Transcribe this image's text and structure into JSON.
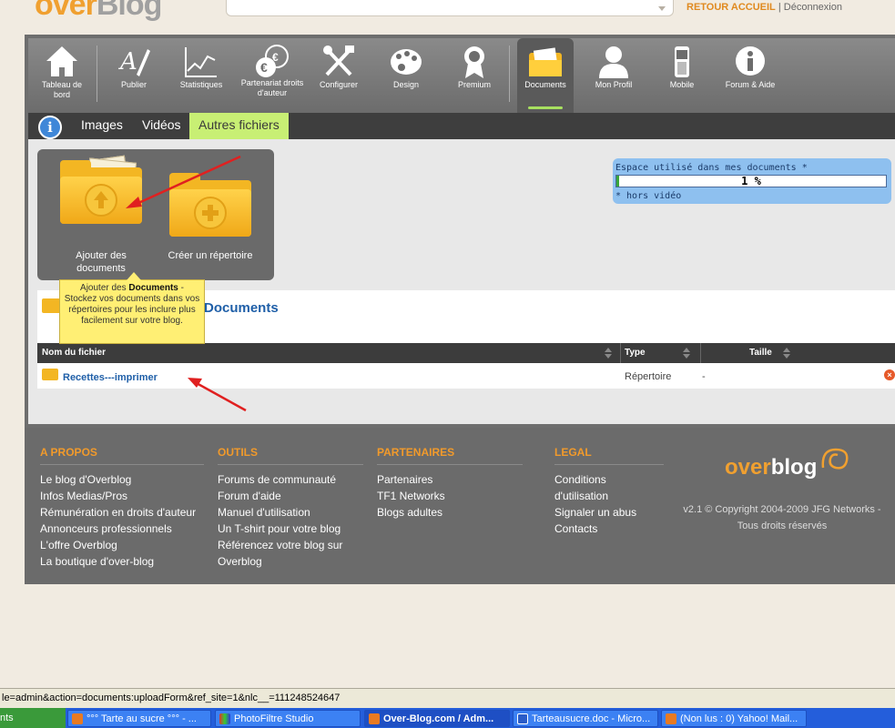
{
  "header": {
    "logo_prefix": "over",
    "logo_suffix": "Blog",
    "home_link": "RETOUR ACCUEIL",
    "separator": " | ",
    "logout_link": "Déconnexion"
  },
  "nav": {
    "items": [
      {
        "label": "Tableau de bord",
        "icon": "house-icon"
      },
      {
        "label": "Publier",
        "icon": "pen-icon"
      },
      {
        "label": "Statistiques",
        "icon": "chart-icon"
      },
      {
        "label": "Partenariat droits d'auteur",
        "icon": "euro-icon"
      },
      {
        "label": "Configurer",
        "icon": "tools-icon"
      },
      {
        "label": "Design",
        "icon": "palette-icon"
      },
      {
        "label": "Premium",
        "icon": "ribbon-icon"
      },
      {
        "label": "Documents",
        "icon": "folder-icon"
      },
      {
        "label": "Mon Profil",
        "icon": "user-icon"
      },
      {
        "label": "Mobile",
        "icon": "phone-icon"
      },
      {
        "label": "Forum & Aide",
        "icon": "info-icon"
      }
    ],
    "active": "Documents"
  },
  "subnav": {
    "tabs": [
      "Images",
      "Vidéos",
      "Autres fichiers"
    ],
    "active": "Autres fichiers"
  },
  "actions": {
    "add": "Ajouter des documents",
    "create": "Créer un répertoire"
  },
  "tooltip": {
    "prefix": "Ajouter des ",
    "bold": "Documents",
    "suffix": " - Stockez vos documents dans vos répertoires pour les inclure plus facilement sur votre blog."
  },
  "quota": {
    "title": "Espace utilisé dans mes documents *",
    "percent_label": "1 %",
    "percent_value": 1,
    "note": "* hors vidéo"
  },
  "documents": {
    "title": "Documents",
    "columns": [
      "Nom du fichier",
      "Type",
      "Taille"
    ],
    "rows": [
      {
        "name": "Recettes---imprimer",
        "type": "Répertoire",
        "size": "-"
      }
    ]
  },
  "footer": {
    "columns": [
      {
        "title": "A PROPOS",
        "links": [
          "Le blog d'Overblog",
          "Infos Medias/Pros",
          "Rémunération en droits d'auteur",
          "Annonceurs professionnels",
          "L'offre Overblog",
          "La boutique d'over-blog"
        ]
      },
      {
        "title": "OUTILS",
        "links": [
          "Forums de communauté",
          "Forum d'aide",
          "Manuel d'utilisation",
          "Un T-shirt pour votre blog",
          "Référencez votre blog sur",
          "Overblog"
        ]
      },
      {
        "title": "PARTENAIRES",
        "links": [
          "Partenaires",
          "TF1 Networks",
          "Blogs adultes"
        ]
      },
      {
        "title": "LEGAL",
        "links": [
          "Conditions",
          "d'utilisation",
          "Signaler un abus",
          "Contacts"
        ]
      }
    ],
    "logo_prefix": "over",
    "logo_suffix": "blog",
    "copyright_1": "v2.1 © Copyright 2004-2009 JFG Networks -",
    "copyright_2": "Tous droits réservés"
  },
  "statusbar": {
    "url": "le=admin&action=documents:uploadForm&ref_site=1&nlc__=111248524647"
  },
  "taskbar": {
    "start": "nts",
    "tasks": [
      {
        "label": "°°° Tarte au sucre °°° - ...",
        "icon": "firefox-icon"
      },
      {
        "label": "PhotoFiltre Studio",
        "icon": "photofiltre-icon"
      },
      {
        "label": "Over-Blog.com / Adm...",
        "icon": "firefox-icon"
      },
      {
        "label": "Tarteausucre.doc - Micro...",
        "icon": "word-icon"
      },
      {
        "label": "(Non lus : 0) Yahoo! Mail...",
        "icon": "firefox-icon"
      }
    ]
  }
}
